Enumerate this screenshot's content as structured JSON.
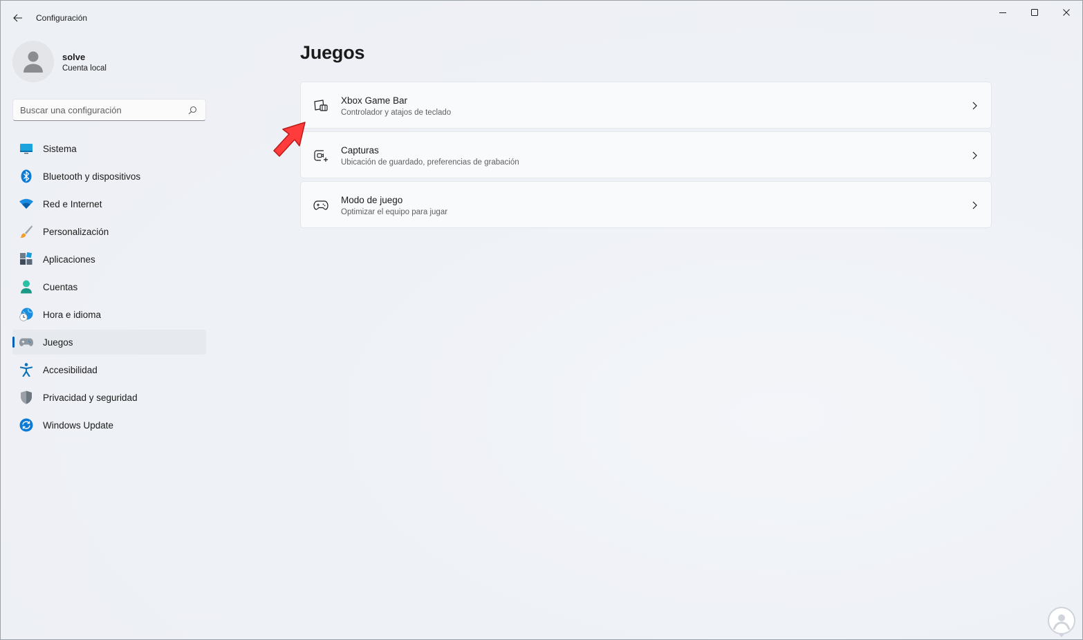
{
  "window": {
    "title": "Configuración",
    "icons": {
      "back": "back-arrow-icon",
      "minimize": "minimize-icon",
      "maximize": "maximize-icon",
      "close": "close-icon"
    }
  },
  "profile": {
    "name": "solve",
    "account_type": "Cuenta local",
    "icon": "user-avatar-icon"
  },
  "search": {
    "placeholder": "Buscar una configuración",
    "value": "",
    "icon": "search-icon"
  },
  "sidebar": {
    "items": [
      {
        "label": "Sistema",
        "icon": "monitor-icon",
        "active": false
      },
      {
        "label": "Bluetooth y dispositivos",
        "icon": "bluetooth-icon",
        "active": false
      },
      {
        "label": "Red e Internet",
        "icon": "wifi-icon",
        "active": false
      },
      {
        "label": "Personalización",
        "icon": "paintbrush-icon",
        "active": false
      },
      {
        "label": "Aplicaciones",
        "icon": "apps-icon",
        "active": false
      },
      {
        "label": "Cuentas",
        "icon": "person-icon",
        "active": false
      },
      {
        "label": "Hora e idioma",
        "icon": "globe-clock-icon",
        "active": false
      },
      {
        "label": "Juegos",
        "icon": "gamepad-icon",
        "active": true
      },
      {
        "label": "Accesibilidad",
        "icon": "accessibility-icon",
        "active": false
      },
      {
        "label": "Privacidad y seguridad",
        "icon": "shield-icon",
        "active": false
      },
      {
        "label": "Windows Update",
        "icon": "update-icon",
        "active": false
      }
    ]
  },
  "main": {
    "title": "Juegos",
    "cards": [
      {
        "title": "Xbox Game Bar",
        "subtitle": "Controlador y atajos de teclado",
        "icon": "game-bar-icon"
      },
      {
        "title": "Capturas",
        "subtitle": "Ubicación de guardado, preferencias de grabación",
        "icon": "capture-icon"
      },
      {
        "title": "Modo de juego",
        "subtitle": "Optimizar el equipo para jugar",
        "icon": "game-mode-icon"
      }
    ]
  },
  "colors": {
    "accent": "#005fb8",
    "background": "#eef1f6",
    "card": "#f9fafb",
    "annotation_arrow": "#ff3b3b"
  }
}
